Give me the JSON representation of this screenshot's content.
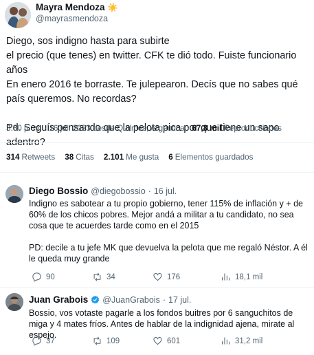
{
  "main_tweet": {
    "author_name": "Mayra Mendoza",
    "author_emoji": "☀️",
    "author_handle": "@mayrasmendoza",
    "text": "Diego, sos indigno hasta para subirte\n el precio (que tenes) en twitter. CFK te dió todo. Fuiste funcionario años\nEn enero 2016 te borraste. Te julepearon. Decís que no sabes qué país queremos. No recordas?\n\nPd. Seguís pensando que la pelota pica por que tiene un sapo adentro?",
    "time": "3:30 p. m.",
    "date": "16 jul. 2023",
    "location": "desde Quilmes, Argentina",
    "views_count": "67,8 mil",
    "views_label": "Reproducciones",
    "separator": "·"
  },
  "stats": [
    {
      "count": "314",
      "label": "Retweets"
    },
    {
      "count": "38",
      "label": "Citas"
    },
    {
      "count": "2.101",
      "label": "Me gusta"
    },
    {
      "count": "6",
      "label": "Elementos guardados"
    }
  ],
  "replies": [
    {
      "name": "Diego Bossio",
      "handle": "@diegobossio",
      "separator": "·",
      "date": "16 jul.",
      "verified": false,
      "text": "Indigno es sabotear a tu propio gobierno, tener 115% de inflación y + de 60% de los chicos pobres. Mejor andá a militar a tu candidato, no sea cosa que te acuerdes tarde como en el 2015\n\nPD: decile a tu jefe MK que devuelva la pelota que me regaló Néstor. A él le queda muy grande",
      "actions": {
        "replies": "90",
        "retweets": "34",
        "likes": "176",
        "views": "18,1 mil"
      }
    },
    {
      "name": "Juan Grabois",
      "handle": "@JuanGrabois",
      "separator": "·",
      "date": "17 jul.",
      "verified": true,
      "text": "Bossio, vos votaste pagarle a los fondos buitres por 6 sanguchitos de miga y 4 mates fríos. Antes de hablar de la indignidad ajena, mirate al espejo.",
      "actions": {
        "replies": "37",
        "retweets": "109",
        "likes": "601",
        "views": "31,2 mil"
      }
    }
  ],
  "colors": {
    "text": "#0f1419",
    "secondary": "#536471",
    "divider": "#eff3f4",
    "verified": "#1d9bf0"
  }
}
